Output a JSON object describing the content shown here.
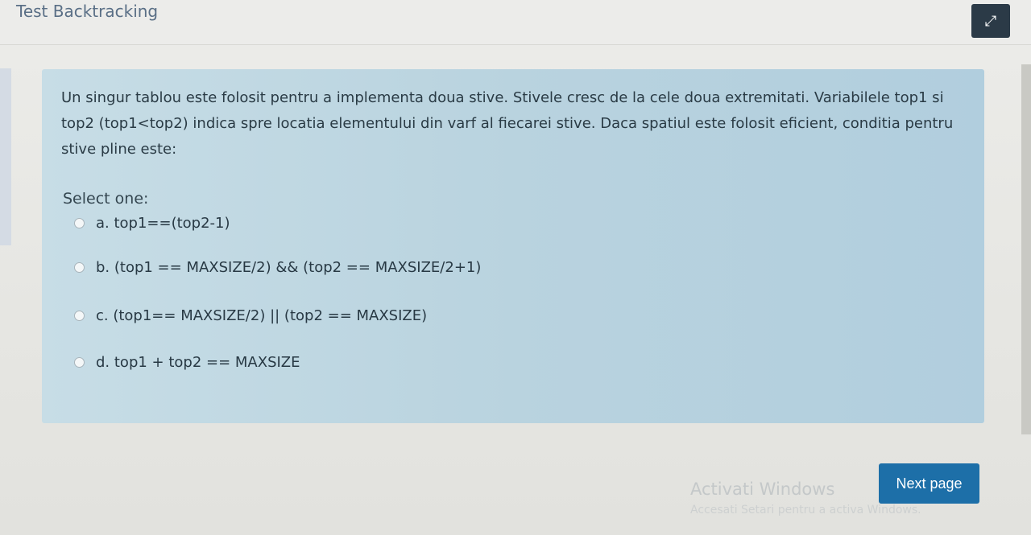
{
  "header": {
    "breadcrumb": "Test Backtracking",
    "fullscreen_icon": "collapse-arrows-icon"
  },
  "question": {
    "text": "Un singur tablou este folosit pentru a implementa doua stive. Stivele cresc de la cele doua extremitati. Variabilele top1 si top2 (top1<top2) indica spre locatia elementului din varf al fiecarei stive. Daca spatiul este folosit eficient, conditia pentru stive pline este:",
    "prompt": "Select one:",
    "answers": [
      {
        "label": "a. top1==(top2-1)"
      },
      {
        "label": "b. (top1 == MAXSIZE/2) && (top2 == MAXSIZE/2+1)"
      },
      {
        "label": "c. (top1== MAXSIZE/2) || (top2 == MAXSIZE)"
      },
      {
        "label": "d. top1 + top2 == MAXSIZE"
      }
    ]
  },
  "footer": {
    "next_label": "Next page"
  },
  "watermark": {
    "title": "Activati Windows",
    "subtitle": "Accesati Setari pentru a activa Windows."
  },
  "colors": {
    "question_bg": "#b9d3df",
    "button_bg": "#1d6fa8",
    "breadcrumb_link": "#5a6f86"
  }
}
